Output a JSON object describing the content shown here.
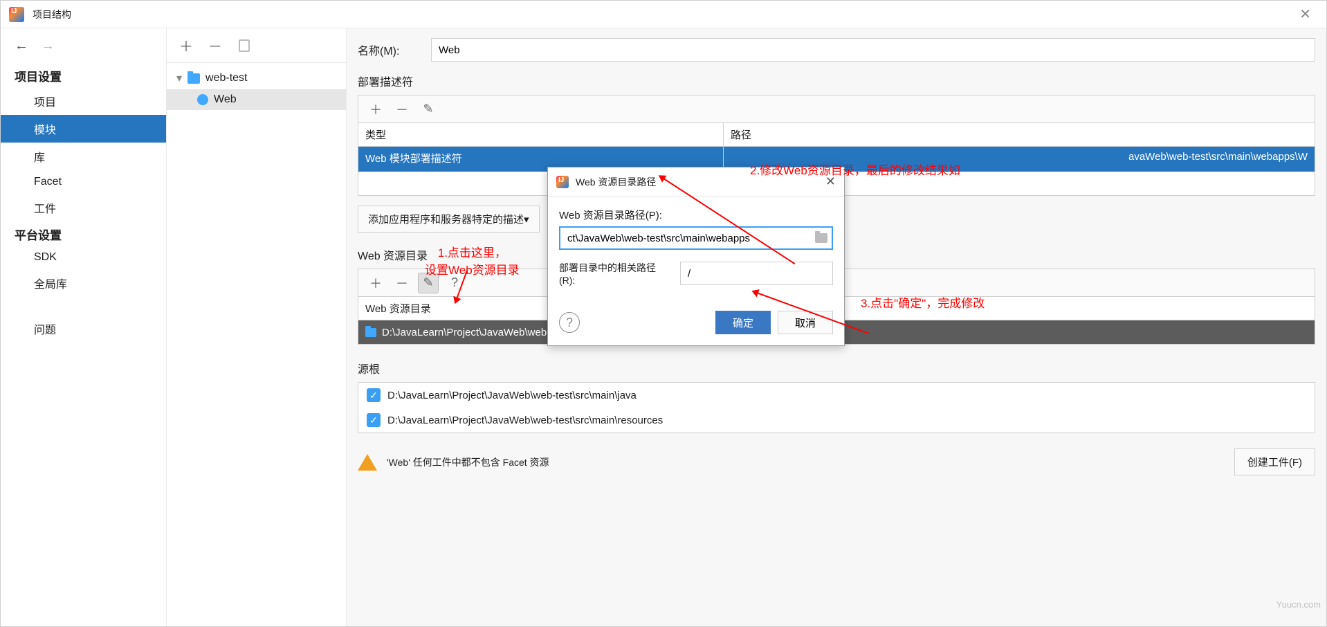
{
  "window": {
    "title": "项目结构"
  },
  "nav": {
    "header_project": "项目设置",
    "items_project": [
      "项目",
      "模块",
      "库",
      "Facet",
      "工件"
    ],
    "header_platform": "平台设置",
    "items_platform": [
      "SDK",
      "全局库"
    ],
    "problems": "问题"
  },
  "tree": {
    "root": "web-test",
    "child": "Web"
  },
  "form": {
    "name_label": "名称(M):",
    "name_value": "Web",
    "deploy_section": "部署描述符",
    "table_headers": {
      "type": "类型",
      "path": "路径"
    },
    "deploy_row": {
      "type": "Web 模块部署描述符",
      "path_fragment": "avaWeb\\web-test\\src\\main\\webapps\\W"
    },
    "add_desc_btn": "添加应用程序和服务器特定的描述",
    "web_res_section": "Web 资源目录",
    "web_res_header": "Web 资源目录",
    "web_res_row": {
      "dir": "D:\\JavaLearn\\Project\\JavaWeb\\web-test\\web2",
      "rel": "/"
    },
    "source_root_section": "源根",
    "source_roots": [
      "D:\\JavaLearn\\Project\\JavaWeb\\web-test\\src\\main\\java",
      "D:\\JavaLearn\\Project\\JavaWeb\\web-test\\src\\main\\resources"
    ],
    "warning_text": "'Web' 任何工件中都不包含 Facet 资源",
    "create_artifact_btn": "创建工件(F)"
  },
  "dialog": {
    "title": "Web 资源目录路径",
    "path_label": "Web 资源目录路径(P):",
    "path_value": "ct\\JavaWeb\\web-test\\src\\main\\webapps",
    "rel_label": "部署目录中的相关路径(R):",
    "rel_value": "/",
    "ok": "确定",
    "cancel": "取消"
  },
  "annotations": {
    "a1_line1": "1.点击这里，",
    "a1_line2": "设置Web资源目录",
    "a2": "2.修改Web资源目录，最后的修改结果如",
    "a3": "3.点击\"确定\"，完成修改"
  },
  "watermark": "Yuucn.com"
}
